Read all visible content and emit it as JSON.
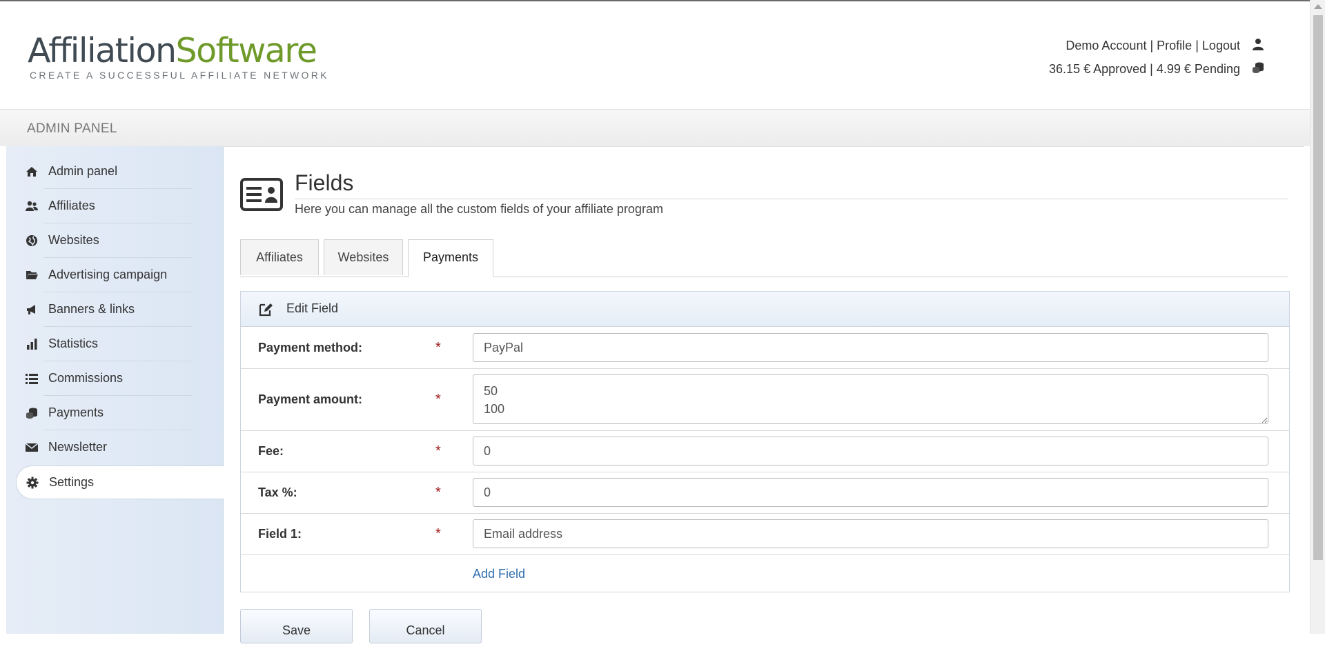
{
  "logo": {
    "part1": "Affiliation",
    "part2": "Software",
    "tagline": "CREATE A SUCCESSFUL AFFILIATE NETWORK"
  },
  "account": {
    "demo_label": "Demo Account",
    "profile_label": "Profile",
    "logout_label": "Logout",
    "approved": "36.15 € Approved",
    "pending": "4.99 € Pending",
    "separator": "|"
  },
  "panel_title": "ADMIN PANEL",
  "sidebar": {
    "items": [
      {
        "label": "Admin panel",
        "icon": "home-icon"
      },
      {
        "label": "Affiliates",
        "icon": "users-icon"
      },
      {
        "label": "Websites",
        "icon": "globe-icon"
      },
      {
        "label": "Advertising campaign",
        "icon": "folder-icon"
      },
      {
        "label": "Banners & links",
        "icon": "megaphone-icon"
      },
      {
        "label": "Statistics",
        "icon": "bar-chart-icon"
      },
      {
        "label": "Commissions",
        "icon": "list-icon"
      },
      {
        "label": "Payments",
        "icon": "coins-icon"
      },
      {
        "label": "Newsletter",
        "icon": "envelope-icon"
      },
      {
        "label": "Settings",
        "icon": "gear-icon",
        "active": true
      }
    ]
  },
  "page": {
    "title": "Fields",
    "subtitle": "Here you can manage all the custom fields of your affiliate program"
  },
  "tabs": [
    {
      "label": "Affiliates"
    },
    {
      "label": "Websites"
    },
    {
      "label": "Payments",
      "active": true
    }
  ],
  "edit_box": {
    "title": "Edit Field",
    "fields": [
      {
        "label": "Payment method:",
        "value": "PayPal",
        "required": "*"
      },
      {
        "label": "Payment amount:",
        "value": "50\n100",
        "required": "*"
      },
      {
        "label": "Fee:",
        "value": "0",
        "required": "*"
      },
      {
        "label": "Tax %:",
        "value": "0",
        "required": "*"
      },
      {
        "label": "Field 1:",
        "value": "Email address",
        "required": "*"
      }
    ],
    "add_field_label": "Add Field"
  },
  "buttons": {
    "save": "Save",
    "cancel": "Cancel"
  },
  "colors": {
    "logo_dark": "#3f4a52",
    "logo_green": "#6f9a2a",
    "link": "#2f6fb0",
    "required": "#a01818",
    "sidebar_bg": "#dbe6f4"
  }
}
